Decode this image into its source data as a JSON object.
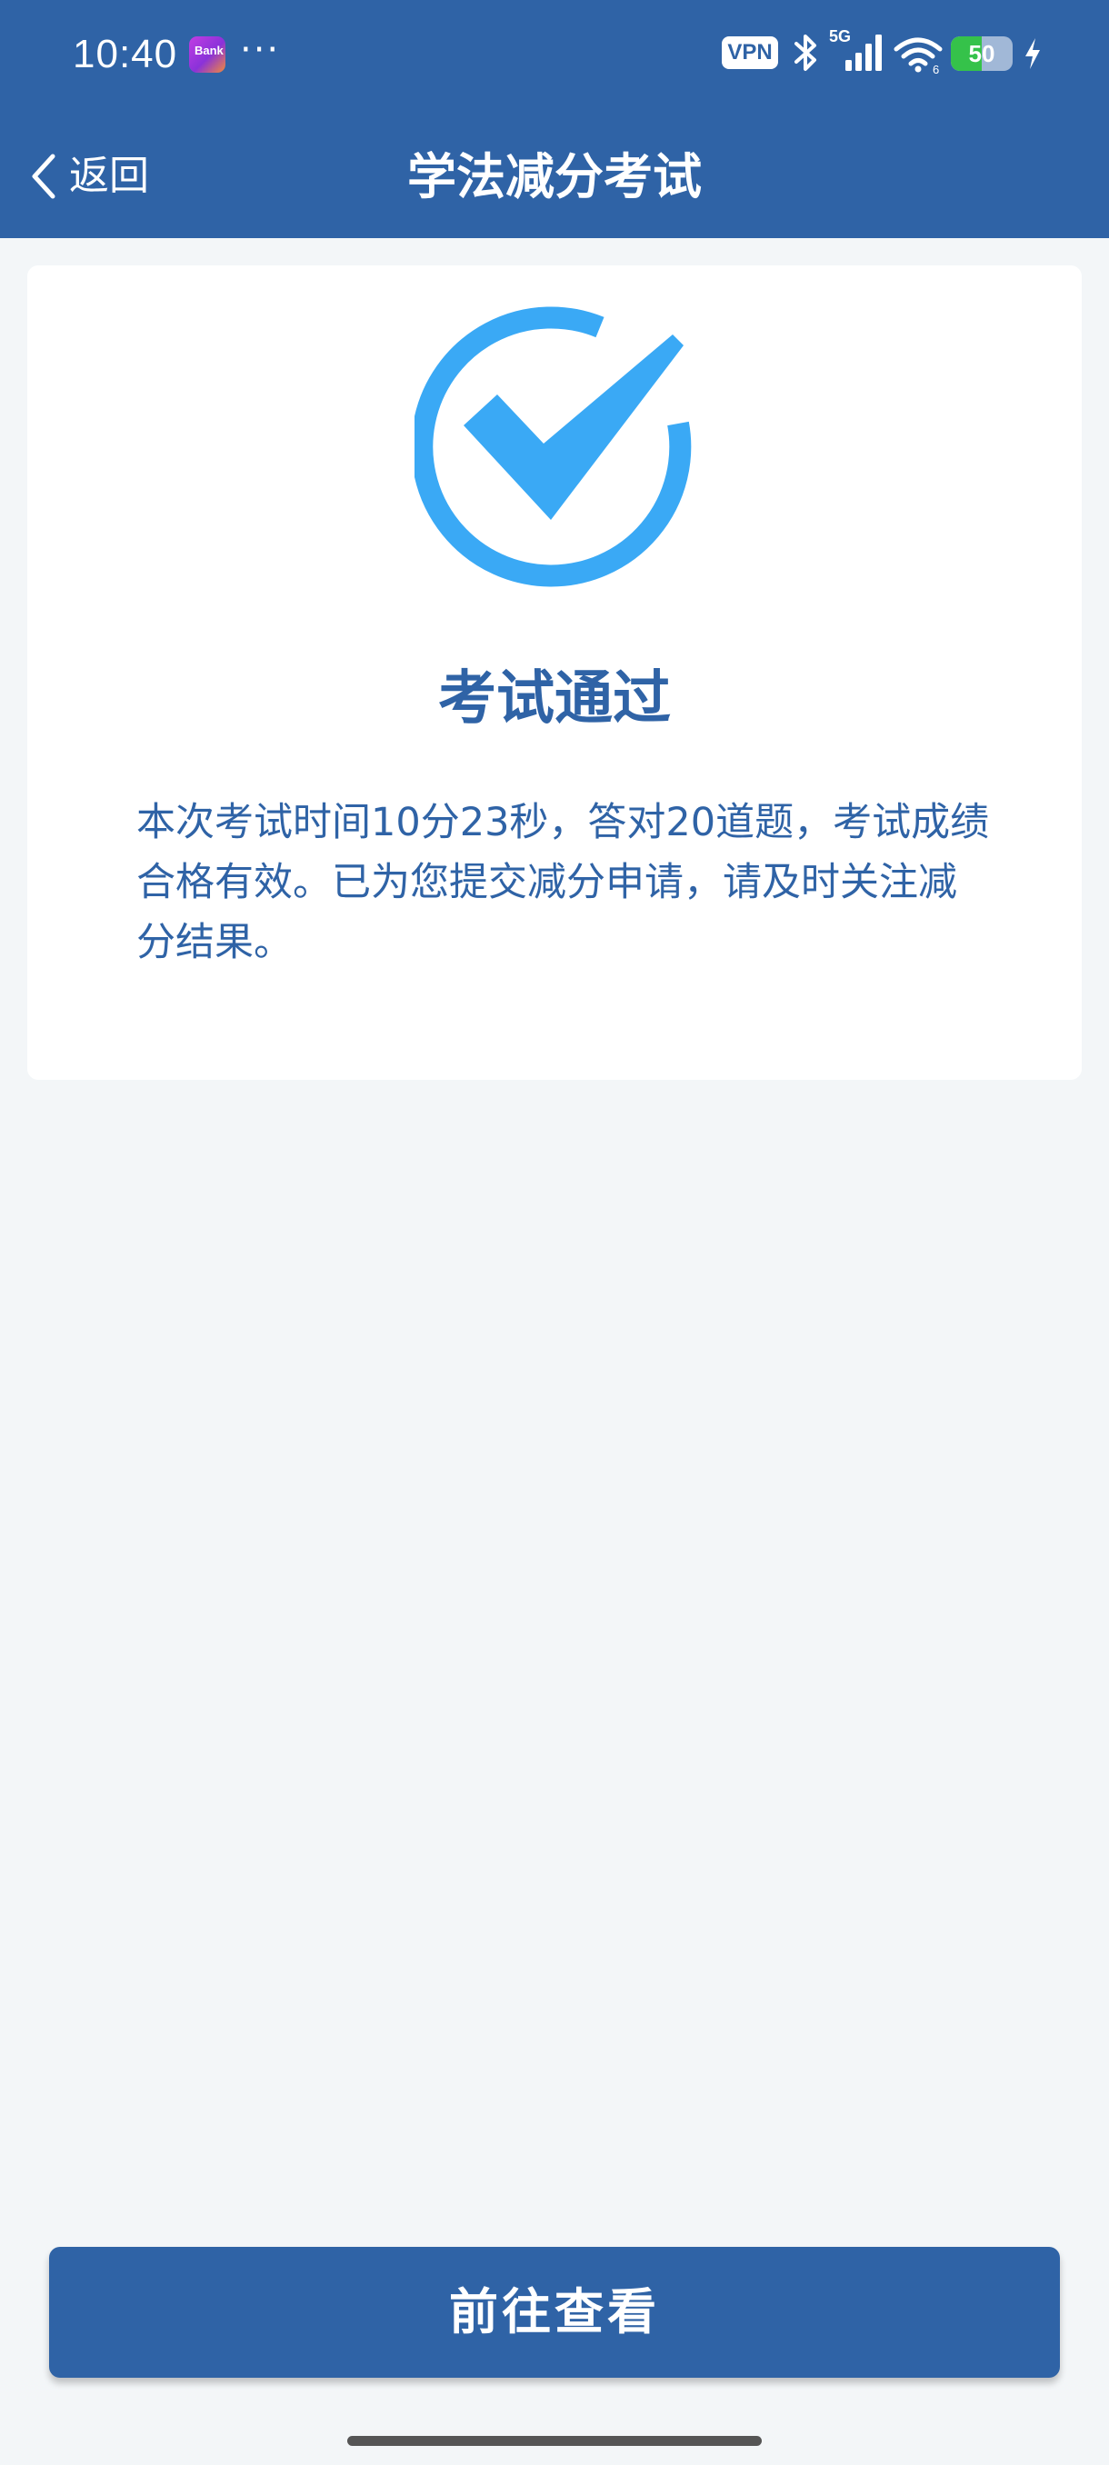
{
  "status_bar": {
    "time": "10:40",
    "app_badge_text": "Bank",
    "more": "···",
    "vpn": "VPN",
    "network": "5G",
    "wifi_level": "6",
    "battery_percent": 50,
    "battery_label": "50"
  },
  "nav": {
    "back_label": "返回",
    "title": "学法减分考试"
  },
  "result": {
    "title": "考试通过",
    "description": "本次考试时间10分23秒，答对20道题，考试成绩合格有效。已为您提交减分申请，请及时关注减分结果。"
  },
  "button": {
    "label": "前往查看"
  },
  "colors": {
    "primary": "#2f63a6",
    "check": "#3aa9f5",
    "background": "#f3f6f8",
    "battery": "#35c24a"
  }
}
